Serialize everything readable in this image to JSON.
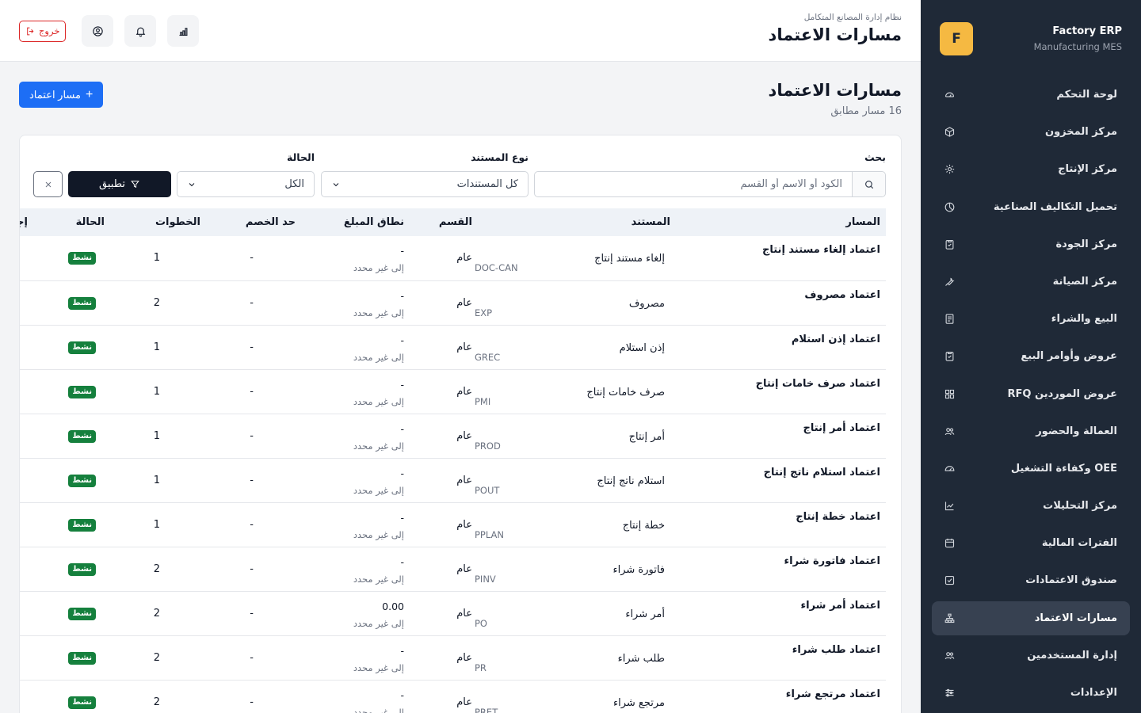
{
  "sidebar": {
    "brand_logo": "F",
    "brand_name": "Factory ERP",
    "brand_sub": "Manufacturing MES",
    "items": [
      {
        "label": "لوحة التحكم",
        "icon": "gauge-icon"
      },
      {
        "label": "مركز المخزون",
        "icon": "box-icon"
      },
      {
        "label": "مركز الإنتاج",
        "icon": "cog-icon"
      },
      {
        "label": "تحميل التكاليف الصناعية",
        "icon": "pie-chart-icon"
      },
      {
        "label": "مركز الجودة",
        "icon": "clipboard-check-icon"
      },
      {
        "label": "مركز الصيانة",
        "icon": "wrench-icon"
      },
      {
        "label": "البيع والشراء",
        "icon": "ledger-icon"
      },
      {
        "label": "عروض وأوامر البيع",
        "icon": "clipboard-icon"
      },
      {
        "label": "عروض الموردين RFQ",
        "icon": "grid-icon"
      },
      {
        "label": "العمالة والحضور",
        "icon": "users-icon"
      },
      {
        "label": "OEE وكفاءة التشغيل",
        "icon": "speedometer-icon"
      },
      {
        "label": "مركز التحليلات",
        "icon": "trend-icon"
      },
      {
        "label": "الفترات المالية",
        "icon": "calendar-icon"
      },
      {
        "label": "صندوق الاعتمادات",
        "icon": "check-square-icon"
      },
      {
        "label": "مسارات الاعتماد",
        "icon": "sitemap-icon"
      },
      {
        "label": "إدارة المستخدمين",
        "icon": "user-group-icon"
      },
      {
        "label": "الإعدادات",
        "icon": "sliders-icon"
      }
    ]
  },
  "topbar": {
    "subtitle": "نظام إدارة المصانع المتكامل",
    "title": "مسارات الاعتماد",
    "logout_label": "خروج"
  },
  "page": {
    "title": "مسارات الاعتماد",
    "count": "16 مسار مطابق",
    "add_label": "مسار اعتماد"
  },
  "filters": {
    "search_label": "بحث",
    "search_placeholder": "الكود أو الاسم أو القسم",
    "doc_type_label": "نوع المستند",
    "doc_type_value": "كل المستندات",
    "status_label": "الحالة",
    "status_value": "الكل",
    "apply_label": "تطبيق"
  },
  "table": {
    "headers": {
      "route": "المسار",
      "document": "المستند",
      "department": "القسم",
      "amount_range": "نطاق المبلغ",
      "discount_limit": "حد الخصم",
      "steps": "الخطوات",
      "status": "الحالة",
      "action": "إجراء"
    },
    "rows": [
      {
        "route": "اعتماد إلغاء مستند إنتاج",
        "document": "إلغاء مستند إنتاج",
        "code": "DOC-CAN",
        "department": "عام",
        "amount": "-",
        "amount_range": "إلى غير محدد",
        "discount": "-",
        "steps": "1",
        "status": "نشط"
      },
      {
        "route": "اعتماد مصروف",
        "document": "مصروف",
        "code": "EXP",
        "department": "عام",
        "amount": "-",
        "amount_range": "إلى غير محدد",
        "discount": "-",
        "steps": "2",
        "status": "نشط"
      },
      {
        "route": "اعتماد إذن استلام",
        "document": "إذن استلام",
        "code": "GREC",
        "department": "عام",
        "amount": "-",
        "amount_range": "إلى غير محدد",
        "discount": "-",
        "steps": "1",
        "status": "نشط"
      },
      {
        "route": "اعتماد صرف خامات إنتاج",
        "document": "صرف خامات إنتاج",
        "code": "PMI",
        "department": "عام",
        "amount": "-",
        "amount_range": "إلى غير محدد",
        "discount": "-",
        "steps": "1",
        "status": "نشط"
      },
      {
        "route": "اعتماد أمر إنتاج",
        "document": "أمر إنتاج",
        "code": "PROD",
        "department": "عام",
        "amount": "-",
        "amount_range": "إلى غير محدد",
        "discount": "-",
        "steps": "1",
        "status": "نشط"
      },
      {
        "route": "اعتماد استلام ناتج إنتاج",
        "document": "استلام ناتج إنتاج",
        "code": "POUT",
        "department": "عام",
        "amount": "-",
        "amount_range": "إلى غير محدد",
        "discount": "-",
        "steps": "1",
        "status": "نشط"
      },
      {
        "route": "اعتماد خطة إنتاج",
        "document": "خطة إنتاج",
        "code": "PPLAN",
        "department": "عام",
        "amount": "-",
        "amount_range": "إلى غير محدد",
        "discount": "-",
        "steps": "1",
        "status": "نشط"
      },
      {
        "route": "اعتماد فاتورة شراء",
        "document": "فاتورة شراء",
        "code": "PINV",
        "department": "عام",
        "amount": "-",
        "amount_range": "إلى غير محدد",
        "discount": "-",
        "steps": "2",
        "status": "نشط"
      },
      {
        "route": "اعتماد أمر شراء",
        "document": "أمر شراء",
        "code": "PO",
        "department": "عام",
        "amount": "0.00",
        "amount_range": "إلى غير محدد",
        "discount": "-",
        "steps": "2",
        "status": "نشط"
      },
      {
        "route": "اعتماد طلب شراء",
        "document": "طلب شراء",
        "code": "PR",
        "department": "عام",
        "amount": "-",
        "amount_range": "إلى غير محدد",
        "discount": "-",
        "steps": "2",
        "status": "نشط"
      },
      {
        "route": "اعتماد مرتجع شراء",
        "document": "مرتجع شراء",
        "code": "PRET",
        "department": "عام",
        "amount": "-",
        "amount_range": "إلى غير محدد",
        "discount": "-",
        "steps": "2",
        "status": "نشط"
      }
    ]
  },
  "colors": {
    "sidebar_bg": "#1f2937",
    "accent": "#1d6ef5",
    "brand_logo": "#f5b942",
    "status_active": "#15803d",
    "danger": "#dc2626"
  }
}
